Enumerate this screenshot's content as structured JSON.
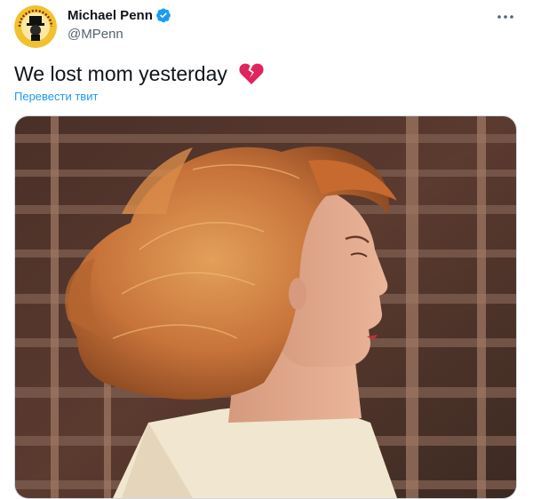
{
  "author": {
    "display_name": "Michael Penn",
    "handle": "@MPenn",
    "verified": true,
    "avatar_text": "IS MY HAT ON STRAIGHT",
    "avatar_bg": "#f2c12e"
  },
  "tweet": {
    "text": "We lost mom yesterday",
    "emoji": "broken-heart-icon",
    "translate_label": "Перевести твит"
  },
  "media": {
    "alt": "photo"
  },
  "colors": {
    "accent": "#1d9bf0",
    "secondary_text": "#536471",
    "primary_text": "#0f1419",
    "heart": "#e0245e"
  },
  "icons": {
    "more": "more-options-icon",
    "verified": "verified-badge-icon"
  }
}
